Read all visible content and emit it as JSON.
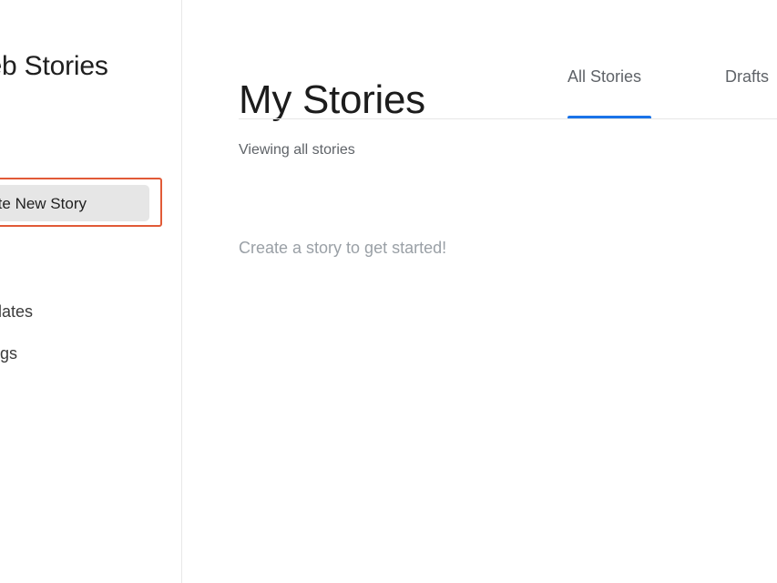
{
  "sidebar": {
    "brand_title": "Web Stories",
    "new_story_label": "Create New Story",
    "items": [
      {
        "label": "Templates"
      },
      {
        "label": "Settings"
      }
    ],
    "highlight_color": "#e15a37"
  },
  "main": {
    "title": "My Stories",
    "tabs": [
      {
        "label": "All Stories",
        "active": true
      },
      {
        "label": "Drafts",
        "active": false
      }
    ],
    "viewing_text": "Viewing all stories",
    "empty_text": "Create a story to get started!",
    "accent_color": "#1a73e8"
  }
}
